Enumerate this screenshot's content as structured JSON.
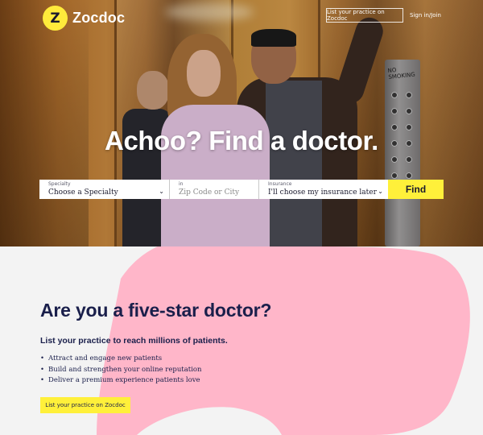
{
  "brand": {
    "name": "Zocdoc",
    "logo_glyph": "Z",
    "yellow": "#fff03a",
    "navy": "#1a1f4b",
    "pink": "#ffb6c9"
  },
  "nav": {
    "list_practice_label": "List your practice on Zocdoc",
    "signin_label": "Sign in/Join"
  },
  "hero": {
    "headline": "Achoo? Find a doctor.",
    "elevator_sign": "NO SMOKING"
  },
  "search": {
    "specialty": {
      "label": "Specialty",
      "value": "Choose a Specialty",
      "icon": "chevron-down-icon"
    },
    "location": {
      "label": "in",
      "placeholder": "Zip Code or City"
    },
    "insurance": {
      "label": "Insurance",
      "value": "I'll choose my insurance later",
      "icon": "chevron-down-icon"
    },
    "find_label": "Find"
  },
  "provider": {
    "title": "Are you a five-star doctor?",
    "subtitle": "List your practice to reach millions of patients.",
    "bullets": [
      "Attract and engage new patients",
      "Build and strengthen your online reputation",
      "Deliver a premium experience patients love"
    ],
    "cta_label": "List your practice on Zocdoc"
  }
}
